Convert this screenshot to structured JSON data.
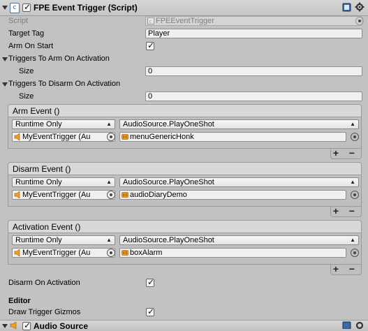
{
  "component": {
    "title": "FPE Event Trigger (Script)",
    "script_label": "Script",
    "script_value": "FPEEventTrigger",
    "target_tag_label": "Target Tag",
    "target_tag_value": "Player",
    "arm_on_start_label": "Arm On Start",
    "arm_on_start_checked": true,
    "triggers_arm_label": "Triggers To Arm On Activation",
    "triggers_arm_size_label": "Size",
    "triggers_arm_size": "0",
    "triggers_disarm_label": "Triggers To Disarm On Activation",
    "triggers_disarm_size_label": "Size",
    "triggers_disarm_size": "0",
    "events": [
      {
        "title": "Arm Event ()",
        "mode": "Runtime Only",
        "function": "AudioSource.PlayOneShot",
        "target": "MyEventTrigger (Au",
        "argument": "menuGenericHonk"
      },
      {
        "title": "Disarm Event ()",
        "mode": "Runtime Only",
        "function": "AudioSource.PlayOneShot",
        "target": "MyEventTrigger (Au",
        "argument": "audioDiaryDemo"
      },
      {
        "title": "Activation Event ()",
        "mode": "Runtime Only",
        "function": "AudioSource.PlayOneShot",
        "target": "MyEventTrigger (Au",
        "argument": "boxAlarm"
      }
    ],
    "plus_label": "+",
    "minus_label": "−",
    "disarm_on_activation_label": "Disarm On Activation",
    "disarm_on_activation_checked": true,
    "editor_header": "Editor",
    "draw_gizmos_label": "Draw Trigger Gizmos",
    "draw_gizmos_checked": true
  },
  "next_component": {
    "title": "Audio Source"
  },
  "icons": {
    "script": "script-icon",
    "help": "help-book-icon",
    "settings": "gear-icon",
    "audio": "speaker-icon",
    "audioclip": "audio-clip-icon",
    "picker": "object-picker-icon"
  },
  "colors": {
    "background": "#c2c2c2",
    "field": "#f0f0f0",
    "audio_icon": "#f0a020"
  }
}
